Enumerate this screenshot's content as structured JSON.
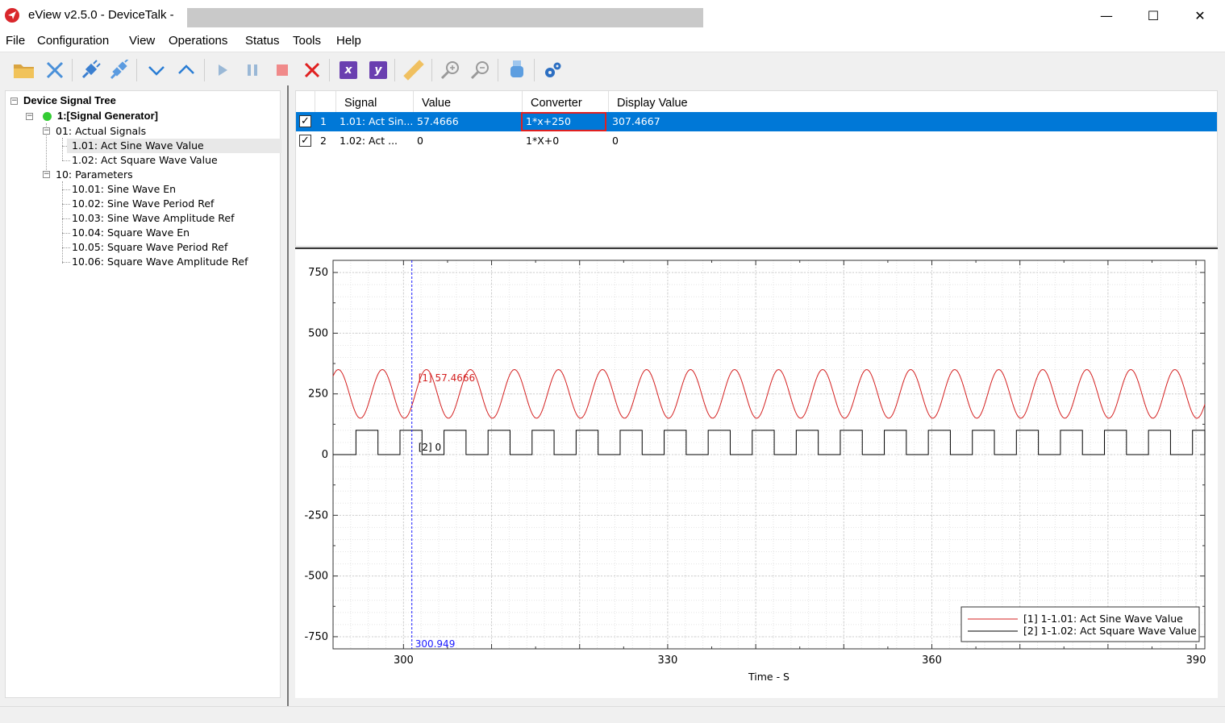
{
  "window": {
    "title": "eView v2.5.0 - DeviceTalk  -",
    "minimize_glyph": "—",
    "maximize_glyph": "☐",
    "close_glyph": "✕"
  },
  "menu": [
    "File",
    "Configuration",
    "View",
    "Operations",
    "Status",
    "Tools",
    "Help"
  ],
  "toolbar": {
    "icons": [
      "open-folder-icon",
      "disconnect-x-icon",
      "connect-plug-icon",
      "disconnect-plug-icon",
      "move-down-icon",
      "move-up-icon",
      "play-icon",
      "pause-icon",
      "stop-icon",
      "delete-icon",
      "x-axis-icon",
      "y-axis-icon",
      "ruler-icon",
      "zoom-in-icon",
      "zoom-out-icon",
      "usb-icon",
      "settings-gears-icon"
    ],
    "x_label": "x",
    "y_label": "y"
  },
  "tree": {
    "root": "Device Signal Tree",
    "device": "1:[Signal Generator]",
    "groups": [
      {
        "label": "01: Actual Signals",
        "items": [
          "1.01: Act Sine Wave Value",
          "1.02: Act Square Wave Value"
        ]
      },
      {
        "label": "10: Parameters",
        "items": [
          "10.01: Sine Wave En",
          "10.02: Sine Wave Period Ref",
          "10.03: Sine Wave Amplitude Ref",
          "10.04: Square Wave En",
          "10.05: Square Wave Period Ref",
          "10.06: Square Wave Amplitude Ref"
        ]
      }
    ]
  },
  "table": {
    "headers": [
      "Signal",
      "Value",
      "Converter",
      "Display Value"
    ],
    "rows": [
      {
        "checked": "✓",
        "index": "1",
        "signal": "1.01: Act Sin...",
        "value": "57.4666",
        "converter": "1*x+250",
        "display": "307.4667"
      },
      {
        "checked": "✓",
        "index": "2",
        "signal": "1.02: Act ...",
        "value": "0",
        "converter": "1*X+0",
        "display": "0"
      }
    ]
  },
  "colors": {
    "selection": "#0078d7",
    "sine": "#d42020",
    "square": "#000000",
    "cursor": "#1a1aff",
    "highlight_box": "#e02020"
  },
  "chart_data": {
    "type": "line",
    "xlabel": "Time - S",
    "x_ticks": [
      "300",
      "330",
      "360",
      "390"
    ],
    "y_ticks": [
      "750",
      "500",
      "250",
      "0",
      "-250",
      "-500",
      "-750"
    ],
    "xlim": [
      292,
      391
    ],
    "ylim": [
      -800,
      800
    ],
    "grid": true,
    "legend_position": "bottom-right",
    "series": [
      {
        "name": "[1] 1-1.01: Act Sine Wave Value",
        "kind": "sine",
        "offset": 250,
        "amplitude": 100,
        "period": 5,
        "phase_peak_x": 292.6
      },
      {
        "name": "[2] 1-1.02: Act Square Wave Value",
        "kind": "square",
        "low": 0,
        "high": 100,
        "period": 5,
        "high_duration": 2.5,
        "first_rise_x": 294.6
      }
    ],
    "cursor": {
      "x": 300.949,
      "label": "300.949"
    },
    "annotations": [
      {
        "series": 0,
        "text": "[1] 57.4666"
      },
      {
        "series": 1,
        "text": "[2] 0"
      }
    ]
  }
}
